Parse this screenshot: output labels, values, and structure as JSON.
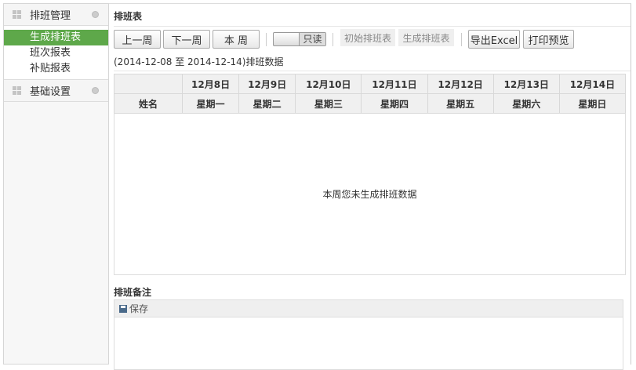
{
  "sidebar": {
    "groups": [
      {
        "label": "排班管理",
        "items": [
          "生成排班表",
          "班次报表",
          "补贴报表"
        ]
      },
      {
        "label": "基础设置"
      }
    ]
  },
  "main": {
    "title": "排班表",
    "toolbar": {
      "prev": "上一周",
      "next": "下一周",
      "current": "本 周",
      "toggle": "只读",
      "init": "初始排班表",
      "generate": "生成排班表",
      "export": "导出Excel",
      "print": "打印预览"
    },
    "range": "(2014-12-08 至 2014-12-14)排班数据",
    "table": {
      "name_header": "姓名",
      "dates": [
        "12月8日",
        "12月9日",
        "12月10日",
        "12月11日",
        "12月12日",
        "12月13日",
        "12月14日"
      ],
      "weekdays": [
        "星期一",
        "星期二",
        "星期三",
        "星期四",
        "星期五",
        "星期六",
        "星期日"
      ],
      "empty": "本周您未生成排班数据"
    },
    "notes": {
      "title": "排班备注",
      "save": "保存"
    }
  }
}
